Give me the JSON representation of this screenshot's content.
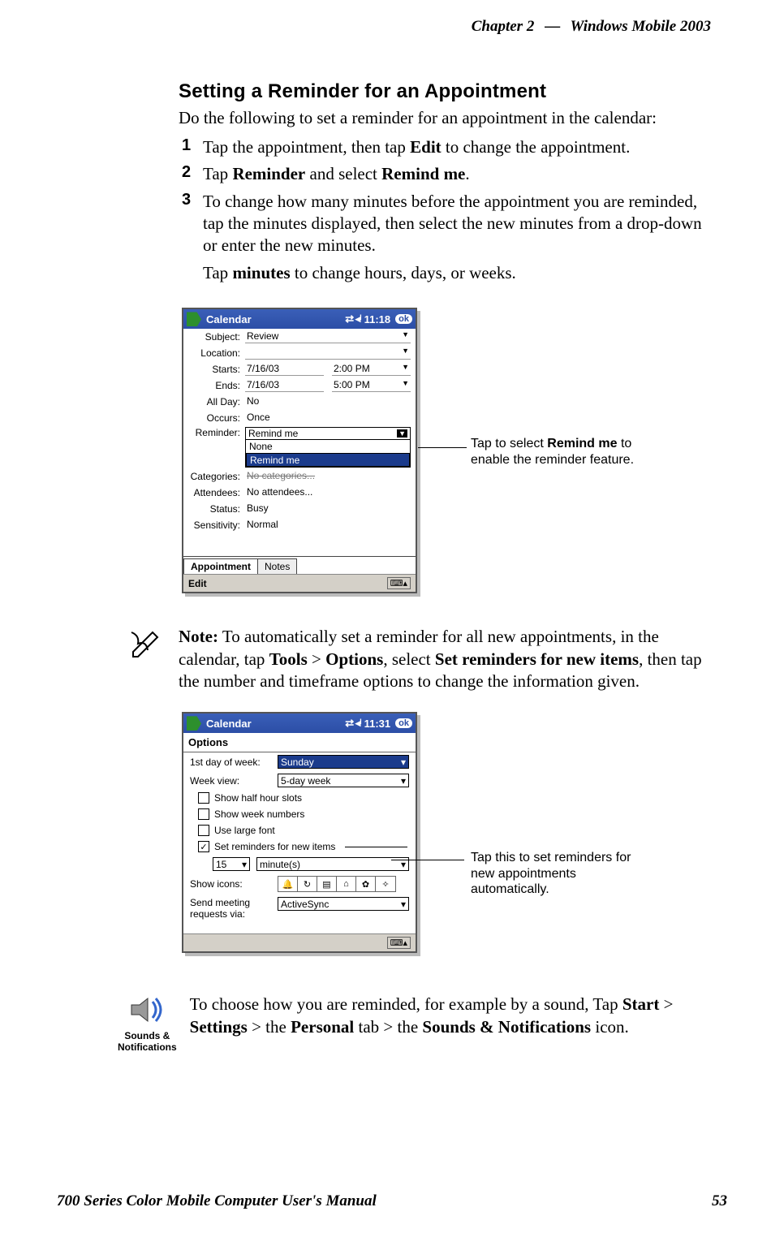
{
  "header": {
    "chapter": "Chapter  2",
    "dash": "—",
    "product": "Windows Mobile 2003"
  },
  "section_title": "Setting a Reminder for an Appointment",
  "intro": "Do the following to set a reminder for an appointment in the calendar:",
  "steps": [
    {
      "num": "1",
      "text_before": "Tap the appointment, then tap ",
      "b1": "Edit",
      "text_after": " to change the appointment."
    },
    {
      "num": "2",
      "text_before": "Tap ",
      "b1": "Reminder",
      "mid": " and select ",
      "b2": "Remind me",
      "end": "."
    },
    {
      "num": "3",
      "text_before": "To change how many minutes before the appointment you are reminded, tap the minutes displayed, then select the new minutes from a drop-down or enter the new minutes."
    }
  ],
  "step3_sub_before": "Tap ",
  "step3_sub_b": "minutes",
  "step3_sub_after": " to change hours, days, or weeks.",
  "pda1": {
    "title": "Calendar",
    "clock": "11:18",
    "ok": "ok",
    "rows": {
      "subject_lbl": "Subject:",
      "subject_val": "Review",
      "location_lbl": "Location:",
      "location_val": "",
      "starts_lbl": "Starts:",
      "starts_date": "7/16/03",
      "starts_time": "2:00 PM",
      "ends_lbl": "Ends:",
      "ends_date": "7/16/03",
      "ends_time": "5:00 PM",
      "allday_lbl": "All Day:",
      "allday_val": "No",
      "occurs_lbl": "Occurs:",
      "occurs_val": "Once",
      "reminder_lbl": "Reminder:",
      "reminder_val": "Remind me",
      "reminder_opt_none": "None",
      "reminder_opt_remind": "Remind me",
      "categories_lbl": "Categories:",
      "categories_val": "No categories...",
      "attendees_lbl": "Attendees:",
      "attendees_val": "No attendees...",
      "status_lbl": "Status:",
      "status_val": "Busy",
      "sensitivity_lbl": "Sensitivity:",
      "sensitivity_val": "Normal"
    },
    "tab_appointment": "Appointment",
    "tab_notes": "Notes",
    "edit": "Edit",
    "kbd": "⌨▴"
  },
  "callout1_a": "Tap to select ",
  "callout1_b": "Remind me",
  "callout1_c": " to enable the reminder feature.",
  "note_b": "Note:",
  "note_1": " To automatically set a reminder for all new appointments, in the calendar, tap ",
  "note_tools": "Tools",
  "note_gt1": " > ",
  "note_options": "Options",
  "note_2": ", select ",
  "note_set": "Set reminders for new items",
  "note_3": ", then tap the number and timeframe options to change the information given.",
  "pda2": {
    "title": "Calendar",
    "clock": "11:31",
    "ok": "ok",
    "options_lbl": "Options",
    "firstday_lbl": "1st day of week:",
    "firstday_val": "Sunday",
    "weekview_lbl": "Week view:",
    "weekview_val": "5-day week",
    "chk_half": "Show half hour slots",
    "chk_weeknum": "Show week numbers",
    "chk_large": "Use large font",
    "chk_setreminders": "Set reminders for new items",
    "rem_qty": "15",
    "rem_unit": "minute(s)",
    "showicons_lbl": "Show icons:",
    "sendvia_lbl": "Send meeting requests via:",
    "sendvia_val": "ActiveSync",
    "kbd": "⌨▴"
  },
  "callout2": "Tap this to set reminders for new appointments automatically.",
  "sounds_label": "Sounds & Notifications",
  "final_1": "To choose how you are reminded, for example by a sound, Tap ",
  "final_start": "Start",
  "final_gt1": " > ",
  "final_settings": "Settings",
  "final_gt2": " > the ",
  "final_personal": "Personal",
  "final_mid": " tab > the ",
  "final_sn": "Sounds & Notifications",
  "final_end": " icon.",
  "footer": {
    "left": "700 Series Color Mobile Computer User's Manual",
    "right": "53"
  }
}
